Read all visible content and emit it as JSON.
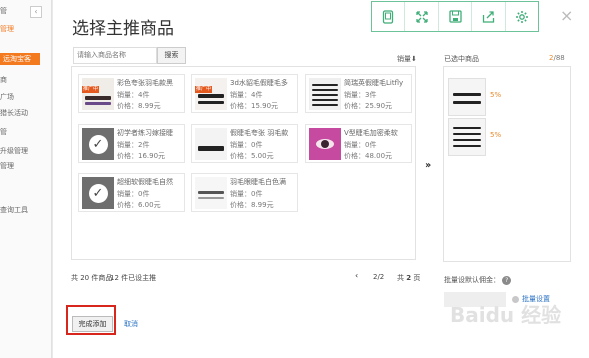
{
  "sidebar": {
    "collapse_glyph": "‹",
    "items": [
      "管",
      "管理",
      "远淘宝客",
      "商",
      "广场",
      "猎长活动",
      "管",
      "升级管理",
      "管理",
      "查询工具"
    ]
  },
  "modal": {
    "title": "选择主推商品",
    "close": "×",
    "toolbar": [
      "tablet-icon",
      "expand-icon",
      "save-icon",
      "share-icon",
      "settings-icon"
    ]
  },
  "search": {
    "placeholder": "请输入商品名称",
    "button": "搜索"
  },
  "sort_label": "销量⬇",
  "products": [
    {
      "name": "彩色夸张羽毛款黑",
      "sales": "销量：4件",
      "price": "价格：8.99元",
      "promo": "推广中",
      "checked": false,
      "thumb": "colorful"
    },
    {
      "name": "3d水貂毛假睫毛多",
      "sales": "销量：4件",
      "price": "价格：15.90元",
      "promo": "推广中",
      "checked": false,
      "thumb": "mink"
    },
    {
      "name": "简瑞英假睫毛Litfly",
      "sales": "销量：3件",
      "price": "价格：25.90元",
      "promo": "",
      "checked": false,
      "thumb": "rows"
    },
    {
      "name": "初学者练习嫁接睫",
      "sales": "销量：2件",
      "price": "价格：16.90元",
      "promo": "",
      "checked": true,
      "thumb": "practice"
    },
    {
      "name": "假睫毛夸张 羽毛款",
      "sales": "销量：0件",
      "price": "价格：5.00元",
      "promo": "",
      "checked": false,
      "thumb": "feather"
    },
    {
      "name": "V型睫毛加密柔软",
      "sales": "销量：0件",
      "price": "价格：48.00元",
      "promo": "",
      "checked": false,
      "thumb": "eye"
    },
    {
      "name": "超细软假睫毛自然",
      "sales": "销量：0件",
      "price": "价格：6.00元",
      "promo": "",
      "checked": true,
      "thumb": "soft"
    },
    {
      "name": "羽毛眼睫毛白色满",
      "sales": "销量：0件",
      "price": "价格：8.99元",
      "promo": "",
      "checked": false,
      "thumb": "white"
    }
  ],
  "move_arrows": "››",
  "stats": {
    "total": "共 20 件商品",
    "promoted": "12 件已设主推"
  },
  "pager": {
    "prev": "‹",
    "current": "2/2",
    "total_prefix": "共",
    "total_pages": "2",
    "total_suffix": "页"
  },
  "selected": {
    "heading": "已选中商品",
    "count": "2",
    "max": "/88",
    "items": [
      {
        "rate": "5%"
      },
      {
        "rate": "5%"
      }
    ]
  },
  "commission": {
    "label": "批量设默认佣金：",
    "help": "?",
    "batch_link": "批量设置"
  },
  "actions": {
    "done": "完成添加",
    "cancel": "取消"
  },
  "watermark": "Baidu 经验",
  "colors": {
    "accent_orange": "#f47a20",
    "toolbar_green": "#6cc39a",
    "link_blue": "#2a72c4",
    "highlight_red": "#d9261c"
  }
}
